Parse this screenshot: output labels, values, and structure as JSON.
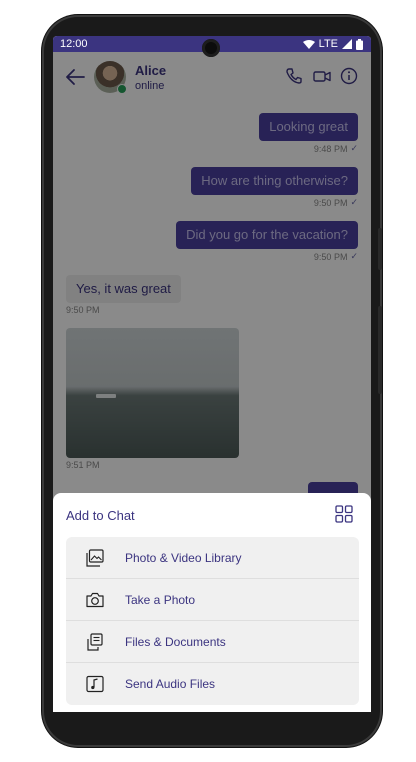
{
  "status_bar": {
    "time": "12:00",
    "network": "LTE"
  },
  "header": {
    "contact_name": "Alice",
    "contact_status": "online"
  },
  "messages": [
    {
      "direction": "out",
      "text": "Looking great",
      "time": "9:48 PM"
    },
    {
      "direction": "out",
      "text": "How are thing otherwise?",
      "time": "9:50 PM"
    },
    {
      "direction": "out",
      "text": "Did you go for the vacation?",
      "time": "9:50 PM"
    },
    {
      "direction": "in",
      "text": "Yes, it was great",
      "time": "9:50 PM"
    },
    {
      "direction": "in",
      "type": "image",
      "time": "9:51 PM"
    }
  ],
  "sheet": {
    "title": "Add to Chat",
    "options": [
      {
        "label": "Photo & Video Library",
        "icon": "photo-library-icon"
      },
      {
        "label": "Take a Photo",
        "icon": "camera-icon"
      },
      {
        "label": "Files & Documents",
        "icon": "documents-icon"
      },
      {
        "label": "Send Audio Files",
        "icon": "audio-file-icon"
      }
    ]
  },
  "colors": {
    "accent": "#3b3480",
    "bubble_out": "#4a3fa0",
    "bubble_in": "#eeeeee",
    "online": "#27a05a"
  }
}
